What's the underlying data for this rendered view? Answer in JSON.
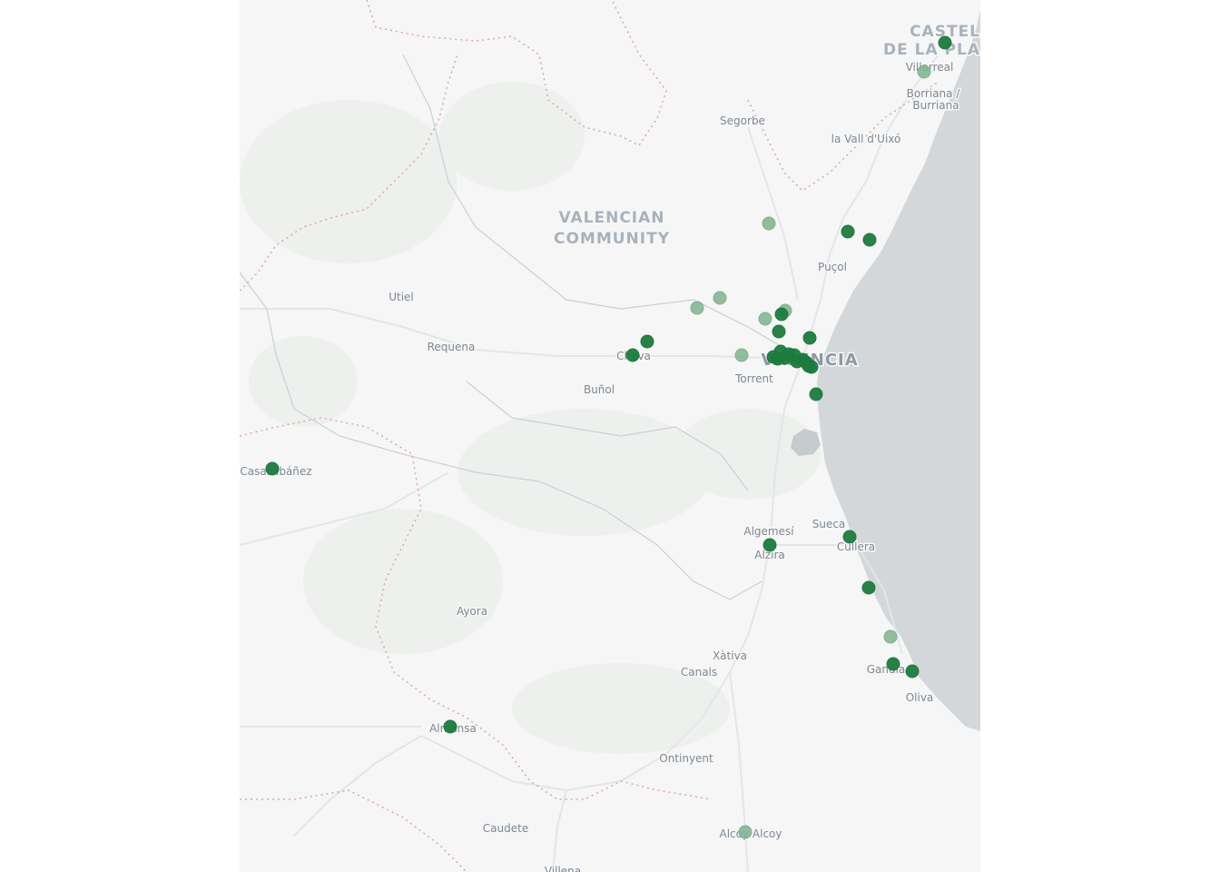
{
  "map": {
    "colors": {
      "land": "#f5f6f5",
      "sea": "#d3d7da",
      "road": "#e4e6e8",
      "border": "#e0a6a6",
      "river": "#c9d0d6",
      "marker_strong": "#1e7a3e",
      "marker_faint": "#7fb28d"
    },
    "labels": {
      "region_line1": "VALENCIAN",
      "region_line2": "COMMUNITY",
      "castellon_line1": "CASTEL",
      "castellon_line2": "DE LA PLA",
      "valencia": "VALENCIA",
      "villarreal": "Villarreal",
      "borriana_line1": "Borriana /",
      "borriana_line2": "Burriana",
      "segorbe": "Segorbe",
      "vall_uixo": "la Vall d'Uixó",
      "pucol": "Puçol",
      "utiel": "Utiel",
      "requena": "Requena",
      "cheste": "Cheva",
      "bunol": "Buñol",
      "torrent": "Torrent",
      "casas_ibanez": "Casas Ibáñez",
      "algemesi": "Algemesí",
      "alzira": "Alzira",
      "sueca": "Sueca",
      "cullera": "Cullera",
      "ayora": "Ayora",
      "xativa": "Xàtiva",
      "canals": "Canals",
      "gandia": "Gandia",
      "oliva": "Oliva",
      "almansa": "Almansa",
      "ontinyent": "Ontinyent",
      "caudete": "Caudete",
      "alcoy": "Alcoy Alcoy",
      "villena": "Villena"
    },
    "markers_strong_count": 27,
    "markers_faint_count": 9
  }
}
